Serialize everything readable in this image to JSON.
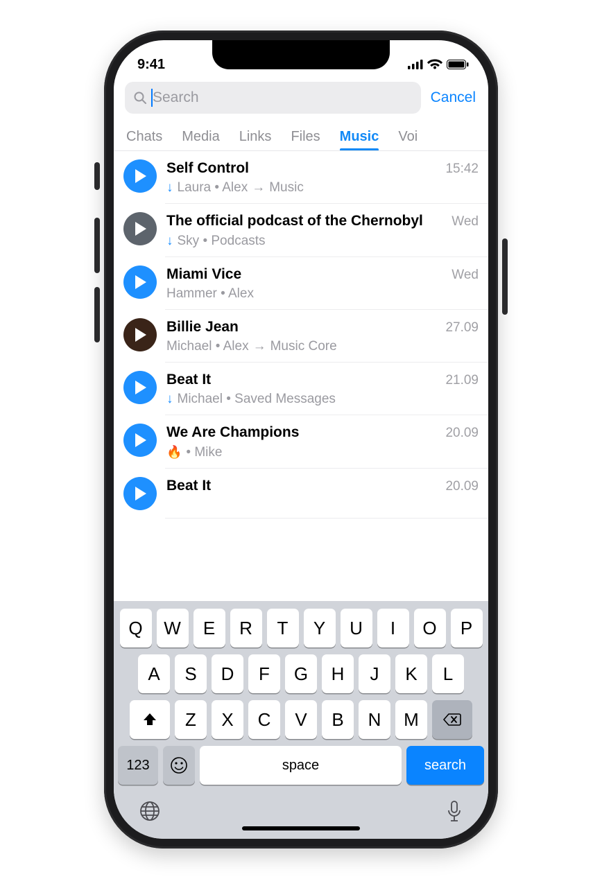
{
  "statusbar": {
    "time": "9:41"
  },
  "search": {
    "placeholder": "Search",
    "value": "",
    "cancel_label": "Cancel"
  },
  "tabs": [
    {
      "label": "Chats",
      "active": false
    },
    {
      "label": "Media",
      "active": false
    },
    {
      "label": "Links",
      "active": false
    },
    {
      "label": "Files",
      "active": false
    },
    {
      "label": "Music",
      "active": true
    },
    {
      "label": "Voi",
      "active": false
    }
  ],
  "items": [
    {
      "title": "Self Control",
      "timestamp": "15:42",
      "download": true,
      "subtitle": "Laura • Alex",
      "forward_to": "Music",
      "avatar_style": "blue"
    },
    {
      "title": "The official podcast of the Chernobyl",
      "timestamp": "Wed",
      "download": true,
      "subtitle": "Sky • Podcasts",
      "forward_to": null,
      "avatar_style": "grey"
    },
    {
      "title": "Miami Vice",
      "timestamp": "Wed",
      "download": false,
      "subtitle": "Hammer • Alex",
      "forward_to": null,
      "avatar_style": "blue"
    },
    {
      "title": "Billie Jean",
      "timestamp": "27.09",
      "download": false,
      "subtitle": "Michael • Alex",
      "forward_to": "Music Core",
      "avatar_style": "photo"
    },
    {
      "title": "Beat It",
      "timestamp": "21.09",
      "download": true,
      "subtitle": "Michael • Saved Messages",
      "forward_to": null,
      "avatar_style": "blue"
    },
    {
      "title": "We Are Champions",
      "timestamp": "20.09",
      "download": false,
      "subtitle_prefix_emoji": "🔥",
      "subtitle": " • Mike",
      "forward_to": null,
      "avatar_style": "blue"
    },
    {
      "title": "Beat It",
      "timestamp": "20.09",
      "download": false,
      "subtitle": "",
      "forward_to": null,
      "avatar_style": "blue"
    }
  ],
  "keyboard": {
    "row1": [
      "Q",
      "W",
      "E",
      "R",
      "T",
      "Y",
      "U",
      "I",
      "O",
      "P"
    ],
    "row2": [
      "A",
      "S",
      "D",
      "F",
      "G",
      "H",
      "J",
      "K",
      "L"
    ],
    "row3": [
      "Z",
      "X",
      "C",
      "V",
      "B",
      "N",
      "M"
    ],
    "numbers_label": "123",
    "space_label": "space",
    "search_label": "search"
  }
}
